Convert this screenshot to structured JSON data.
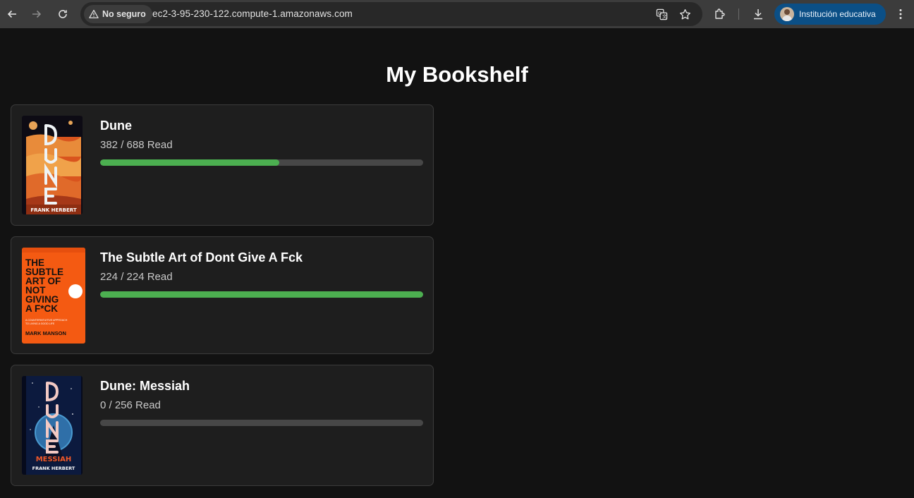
{
  "browser": {
    "security_label": "No seguro",
    "url": "ec2-3-95-230-122.compute-1.amazonaws.com",
    "profile_name": "Institución educativa"
  },
  "page": {
    "title": "My Bookshelf"
  },
  "books": [
    {
      "title": "Dune",
      "progress_text": "382 / 688 Read",
      "pages_read": 382,
      "total_pages": 688,
      "cover": {
        "title_art": "DUNE",
        "author": "FRANK HERBERT"
      }
    },
    {
      "title": "The Subtle Art of Dont Give A Fck",
      "progress_text": "224 / 224 Read",
      "pages_read": 224,
      "total_pages": 224,
      "cover": {
        "title_art": "THE SUBTLE ART OF NOT GIVING A F*CK",
        "author": "MARK MANSON"
      }
    },
    {
      "title": "Dune: Messiah",
      "progress_text": "0 / 256 Read",
      "pages_read": 0,
      "total_pages": 256,
      "cover": {
        "title_art": "DUNE MESSIAH",
        "author": "FRANK HERBERT"
      }
    }
  ],
  "colors": {
    "progress_fill": "#4caf50",
    "progress_track": "#474747",
    "card_bg": "#1e1e1e",
    "page_bg": "#121212"
  }
}
